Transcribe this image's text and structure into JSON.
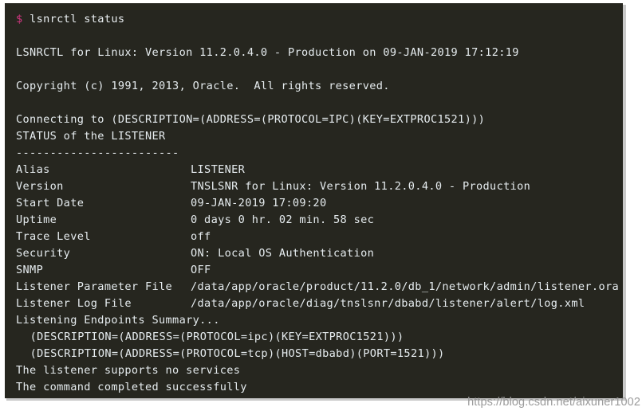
{
  "terminal": {
    "background_color": "#26261f",
    "text_color": "#e6ecef",
    "prompt_color": "#d33682",
    "prompt_symbol": "$",
    "command": "lsnrctl status",
    "lines": {
      "banner": "LSNRCTL for Linux: Version 11.2.0.4.0 - Production on 09-JAN-2019 17:12:19",
      "copyright": "Copyright (c) 1991, 2013, Oracle.  All rights reserved.",
      "connecting": "Connecting to (DESCRIPTION=(ADDRESS=(PROTOCOL=IPC)(KEY=EXTPROC1521)))",
      "status_header": "STATUS of the LISTENER",
      "rule": "------------------------",
      "endpoints_header": "Listening Endpoints Summary...",
      "endpoint_ipc": "(DESCRIPTION=(ADDRESS=(PROTOCOL=ipc)(KEY=EXTPROC1521)))",
      "endpoint_tcp": "(DESCRIPTION=(ADDRESS=(PROTOCOL=tcp)(HOST=dbabd)(PORT=1521)))",
      "services": "The listener supports no services",
      "completed": "The command completed successfully"
    },
    "status_rows": [
      {
        "label": "Alias",
        "value": "LISTENER"
      },
      {
        "label": "Version",
        "value": "TNSLSNR for Linux: Version 11.2.0.4.0 - Production"
      },
      {
        "label": "Start Date",
        "value": "09-JAN-2019 17:09:20"
      },
      {
        "label": "Uptime",
        "value": "0 days 0 hr. 02 min. 58 sec"
      },
      {
        "label": "Trace Level",
        "value": "off"
      },
      {
        "label": "Security",
        "value": "ON: Local OS Authentication"
      },
      {
        "label": "SNMP",
        "value": "OFF"
      },
      {
        "label": "Listener Parameter File",
        "value": "/data/app/oracle/product/11.2.0/db_1/network/admin/listener.ora"
      },
      {
        "label": "Listener Log File",
        "value": "/data/app/oracle/diag/tnslsnr/dbabd/listener/alert/log.xml"
      }
    ]
  },
  "watermark": {
    "text": "https://blog.csdn.net/aixuner1002",
    "color": "#9b9b9b"
  }
}
